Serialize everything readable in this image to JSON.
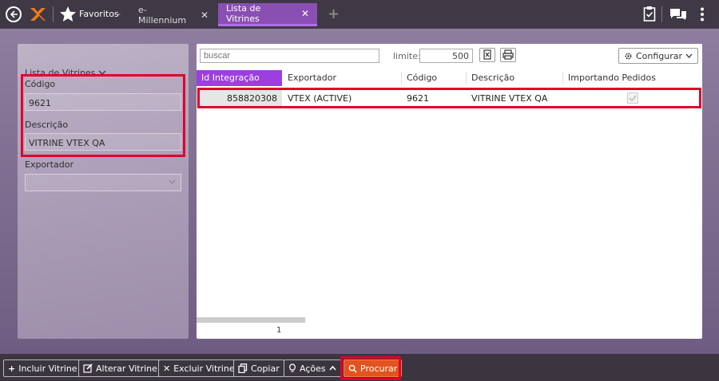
{
  "topbar": {
    "favoritos_label": "Favoritos",
    "favoritos_caret": "-",
    "tabs": [
      {
        "label": "e-Millennium",
        "close": "✕"
      },
      {
        "label": "Lista de Vitrines",
        "close": "✕"
      }
    ],
    "add_tab": "+"
  },
  "filter_panel": {
    "title": "Lista de Vitrines",
    "fields": [
      {
        "label": "Código",
        "value": "9621"
      },
      {
        "label": "Descrição",
        "value": "VITRINE VTEX QA"
      },
      {
        "label": "Exportador",
        "value": ""
      }
    ]
  },
  "grid": {
    "search_placeholder": "buscar",
    "limite_label": "limite:",
    "limite_value": "500",
    "config_label": "Configurar",
    "columns": [
      "Id Integração",
      "Exportador",
      "Código",
      "Descrição",
      "Importando Pedidos"
    ],
    "rows": [
      {
        "id": "858820308",
        "exportador": "VTEX (ACTIVE)",
        "codigo": "9621",
        "descricao": "VITRINE VTEX QA",
        "importando": true
      }
    ],
    "page": "1"
  },
  "toolbar": {
    "incluir": "Incluir Vitrine",
    "alterar": "Alterar Vitrine",
    "excluir": "Excluir Vitrine",
    "copiar": "Copiar",
    "acoes": "Ações",
    "procurar": "Procurar"
  },
  "colors": {
    "accent": "#9b3fe0",
    "highlight": "#e0002a",
    "primary_button": "#e2541f"
  }
}
